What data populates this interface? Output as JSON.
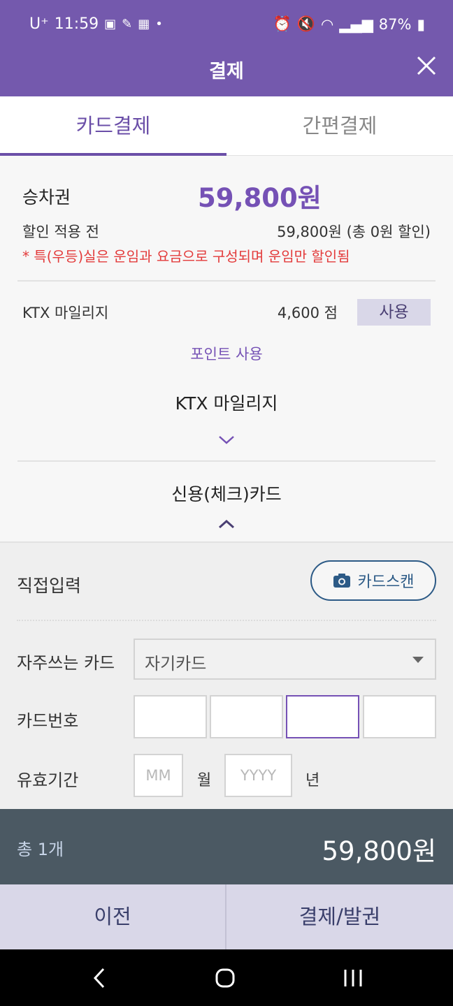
{
  "status": {
    "carrier": "U⁺",
    "time": "11:59",
    "battery": "87%"
  },
  "header": {
    "title": "결제"
  },
  "tabs": [
    {
      "label": "카드결제"
    },
    {
      "label": "간편결제"
    }
  ],
  "summary": {
    "ticket_label": "승차권",
    "ticket_amount": "59,800원",
    "before_discount_label": "할인 적용 전",
    "before_discount_value": "59,800원 (총 0원 할인)",
    "notice": "* 특(우등)실은 운임과 요금으로 구성되며 운임만 할인됨",
    "mileage_label": "KTX 마일리지",
    "mileage_points": "4,600 점",
    "use_button": "사용",
    "point_use": "포인트 사용",
    "ktx_mileage_section": "KTX 마일리지",
    "credit_section": "신용(체크)카드"
  },
  "form": {
    "direct_input": "직접입력",
    "scan_button": "카드스캔",
    "favorite_label": "자주쓰는 카드",
    "favorite_value": "자기카드",
    "card_number_label": "카드번호",
    "expiry_label": "유효기간",
    "month_placeholder": "MM",
    "month_unit": "월",
    "year_placeholder": "YYYY",
    "year_unit": "년"
  },
  "total": {
    "count": "총 1개",
    "amount": "59,800원"
  },
  "actions": {
    "prev": "이전",
    "pay": "결제/발권"
  },
  "colors": {
    "primary": "#7459ad",
    "accent_text": "#7551b5",
    "warning": "#e33b3b",
    "total_bar": "#4b5963"
  }
}
